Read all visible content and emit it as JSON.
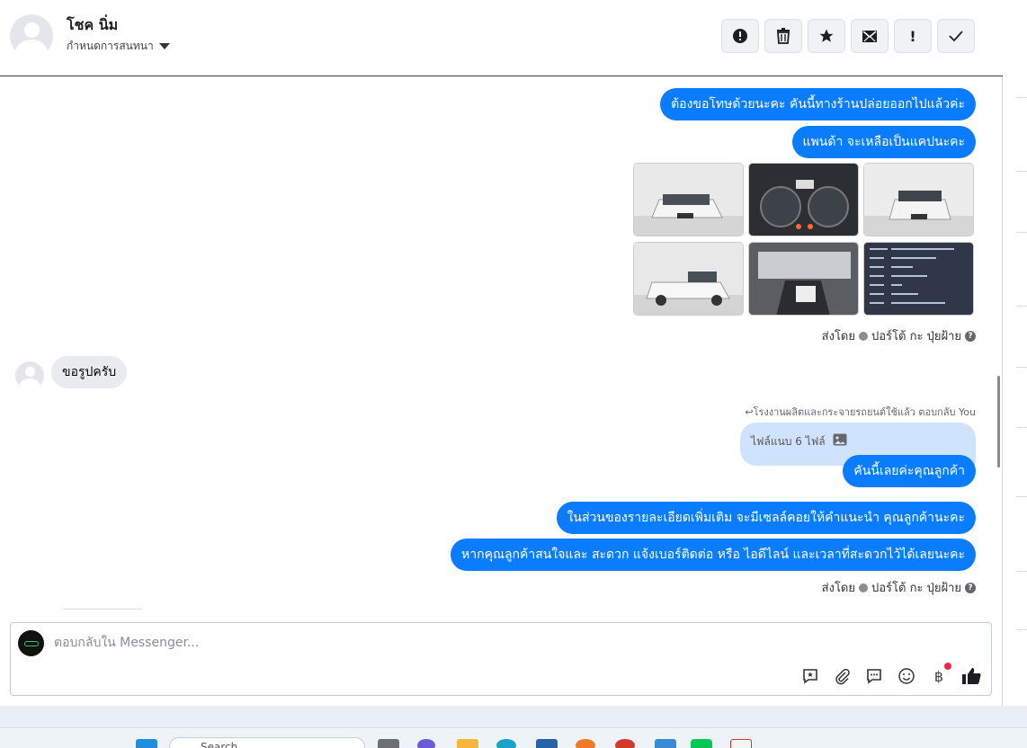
{
  "header": {
    "contact_name": "โชค นิ่ม",
    "subtitle": "กำหนดการสนทนา",
    "actions": [
      {
        "name": "report-icon",
        "glyph": "!"
      },
      {
        "name": "trash-icon",
        "glyph": "🗑"
      },
      {
        "name": "star-icon",
        "glyph": "★"
      },
      {
        "name": "mark-unread-icon",
        "glyph": "✉"
      },
      {
        "name": "follow-up-icon",
        "glyph": "!"
      },
      {
        "name": "done-icon",
        "glyph": "✓"
      }
    ]
  },
  "messages": {
    "out_1": "ต้องขอโทษด้วยนะคะ คันนี้ทางร้านปล่อยออกไปแล้วค่ะ",
    "out_2": "แพนด้า จะเหลือเป็นแคปนะคะ",
    "sent_by_label": "ส่งโดย",
    "sent_by_name": "ปอร์โต้ กะ ปุ่ยฝ้าย",
    "in_1": "ขอรูปครับ",
    "reply_note": "↩โรงงานผลิตและกระจายรถยนต์ใช้แล้ว ตอบกลับ You",
    "attachment_label": "ไฟล์แนบ 6 ไฟล์",
    "out_3": "คันนี้เลยค่ะคุณลูกค้า",
    "out_4": "ในส่วนของรายละเอียดเพิ่มเติม จะมีเซลล์คอยให้คำแนะนำ คุณลูกค้านะคะ",
    "out_5": "หากคุณลูกค้าสนใจและ สะดวก แจ้งเบอร์ติดต่อ หรือ ไอดีไลน์ และเวลาที่สะดวกไว้ได้เลยนะคะ"
  },
  "composer": {
    "placeholder": "ตอบกลับใน Messenger...",
    "tools": [
      "saved-reply-icon",
      "attachment-icon",
      "chat-bubble-icon",
      "emoji-icon",
      "baht-icon",
      "like-icon"
    ]
  },
  "taskbar": {
    "search_text": "Search"
  },
  "colors": {
    "accent": "#0a7cff",
    "incoming_bubble": "#e9ebee",
    "quoted_bubble": "#cfe3fd"
  }
}
